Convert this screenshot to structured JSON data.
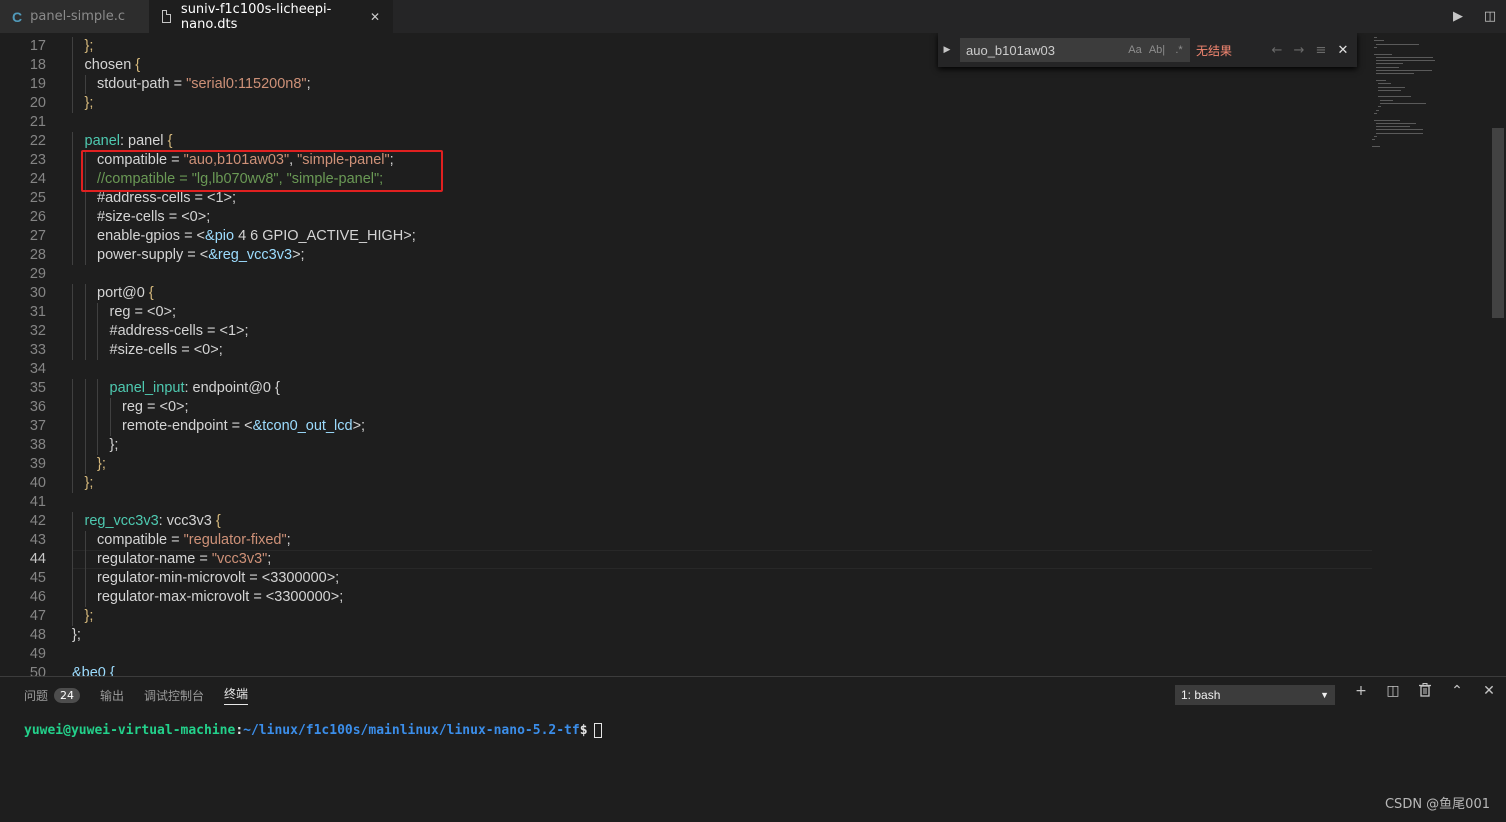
{
  "tabs": [
    {
      "icon": "c-file-icon",
      "label": "panel-simple.c",
      "active": false
    },
    {
      "icon": "file-icon",
      "label": "suniv-f1c100s-licheepi-nano.dts",
      "active": true,
      "close": "✕"
    }
  ],
  "editor_actions": {
    "run": "▶",
    "split": "◫"
  },
  "find": {
    "query": "auo_b101aw03",
    "match_case": "Aa",
    "whole_word": "Ab|",
    "regex": ".*",
    "result": "无结果",
    "prev": "←",
    "next": "→",
    "selection": "≡",
    "close": "✕",
    "toggle": "▶"
  },
  "code_lines": [
    {
      "n": "17",
      "indent": 1,
      "tokens": [
        {
          "t": "};",
          "c": "t-brace"
        }
      ]
    },
    {
      "n": "18",
      "indent": 1,
      "tokens": [
        {
          "t": "chosen ",
          "c": "t-plain"
        },
        {
          "t": "{",
          "c": "t-brace"
        }
      ]
    },
    {
      "n": "19",
      "indent": 2,
      "tokens": [
        {
          "t": "stdout-path = ",
          "c": "t-plain"
        },
        {
          "t": "\"serial0:115200n8\"",
          "c": "t-str"
        },
        {
          "t": ";",
          "c": "t-plain"
        }
      ]
    },
    {
      "n": "20",
      "indent": 1,
      "tokens": [
        {
          "t": "};",
          "c": "t-brace"
        }
      ]
    },
    {
      "n": "21",
      "indent": 0,
      "tokens": []
    },
    {
      "n": "22",
      "indent": 1,
      "tokens": [
        {
          "t": "panel",
          "c": "t-label"
        },
        {
          "t": ": panel ",
          "c": "t-plain"
        },
        {
          "t": "{",
          "c": "t-brace"
        }
      ]
    },
    {
      "n": "23",
      "indent": 2,
      "tokens": [
        {
          "t": "compatible = ",
          "c": "t-plain"
        },
        {
          "t": "\"auo,b101aw03\"",
          "c": "t-str"
        },
        {
          "t": ", ",
          "c": "t-plain"
        },
        {
          "t": "\"simple-panel\"",
          "c": "t-str"
        },
        {
          "t": ";",
          "c": "t-plain"
        }
      ]
    },
    {
      "n": "24",
      "indent": 2,
      "tokens": [
        {
          "t": "//compatible = \"lg,lb070wv8\", \"simple-panel\";",
          "c": "t-comment"
        }
      ]
    },
    {
      "n": "25",
      "indent": 2,
      "tokens": [
        {
          "t": "#address-cells = <1>;",
          "c": "t-plain"
        }
      ]
    },
    {
      "n": "26",
      "indent": 2,
      "tokens": [
        {
          "t": "#size-cells = <0>;",
          "c": "t-plain"
        }
      ]
    },
    {
      "n": "27",
      "indent": 2,
      "tokens": [
        {
          "t": "enable-gpios = <",
          "c": "t-plain"
        },
        {
          "t": "&pio",
          "c": "t-ref"
        },
        {
          "t": " 4 6 GPIO_ACTIVE_HIGH>;",
          "c": "t-plain"
        }
      ]
    },
    {
      "n": "28",
      "indent": 2,
      "tokens": [
        {
          "t": "power-supply = <",
          "c": "t-plain"
        },
        {
          "t": "&reg_vcc3v3",
          "c": "t-ref"
        },
        {
          "t": ">;",
          "c": "t-plain"
        }
      ]
    },
    {
      "n": "29",
      "indent": 0,
      "tokens": []
    },
    {
      "n": "30",
      "indent": 2,
      "tokens": [
        {
          "t": "port@0 ",
          "c": "t-plain"
        },
        {
          "t": "{",
          "c": "t-brace"
        }
      ]
    },
    {
      "n": "31",
      "indent": 3,
      "tokens": [
        {
          "t": "reg = <0>;",
          "c": "t-plain"
        }
      ]
    },
    {
      "n": "32",
      "indent": 3,
      "tokens": [
        {
          "t": "#address-cells = <1>;",
          "c": "t-plain"
        }
      ]
    },
    {
      "n": "33",
      "indent": 3,
      "tokens": [
        {
          "t": "#size-cells = <0>;",
          "c": "t-plain"
        }
      ]
    },
    {
      "n": "34",
      "indent": 0,
      "tokens": []
    },
    {
      "n": "35",
      "indent": 3,
      "tokens": [
        {
          "t": "panel_input",
          "c": "t-label"
        },
        {
          "t": ": endpoint@0 {",
          "c": "t-plain"
        }
      ]
    },
    {
      "n": "36",
      "indent": 4,
      "tokens": [
        {
          "t": "reg = <0>;",
          "c": "t-plain"
        }
      ]
    },
    {
      "n": "37",
      "indent": 4,
      "tokens": [
        {
          "t": "remote-endpoint = <",
          "c": "t-plain"
        },
        {
          "t": "&tcon0_out_lcd",
          "c": "t-ref"
        },
        {
          "t": ">;",
          "c": "t-plain"
        }
      ]
    },
    {
      "n": "38",
      "indent": 3,
      "tokens": [
        {
          "t": "};",
          "c": "t-plain"
        }
      ]
    },
    {
      "n": "39",
      "indent": 2,
      "tokens": [
        {
          "t": "};",
          "c": "t-brace"
        }
      ]
    },
    {
      "n": "40",
      "indent": 1,
      "tokens": [
        {
          "t": "};",
          "c": "t-brace"
        }
      ]
    },
    {
      "n": "41",
      "indent": 0,
      "tokens": []
    },
    {
      "n": "42",
      "indent": 1,
      "tokens": [
        {
          "t": "reg_vcc3v3",
          "c": "t-label"
        },
        {
          "t": ": vcc3v3 ",
          "c": "t-plain"
        },
        {
          "t": "{",
          "c": "t-brace"
        }
      ]
    },
    {
      "n": "43",
      "indent": 2,
      "tokens": [
        {
          "t": "compatible = ",
          "c": "t-plain"
        },
        {
          "t": "\"regulator-fixed\"",
          "c": "t-str"
        },
        {
          "t": ";",
          "c": "t-plain"
        }
      ]
    },
    {
      "n": "44",
      "indent": 2,
      "tokens": [
        {
          "t": "regulator-name = ",
          "c": "t-plain"
        },
        {
          "t": "\"vcc3v3\"",
          "c": "t-str"
        },
        {
          "t": ";",
          "c": "t-plain"
        }
      ]
    },
    {
      "n": "45",
      "indent": 2,
      "tokens": [
        {
          "t": "regulator-min-microvolt = <3300000>;",
          "c": "t-plain"
        }
      ]
    },
    {
      "n": "46",
      "indent": 2,
      "tokens": [
        {
          "t": "regulator-max-microvolt = <3300000>;",
          "c": "t-plain"
        }
      ]
    },
    {
      "n": "47",
      "indent": 1,
      "tokens": [
        {
          "t": "};",
          "c": "t-brace"
        }
      ]
    },
    {
      "n": "48",
      "indent": 0,
      "tokens": [
        {
          "t": "};",
          "c": "t-plain"
        }
      ]
    },
    {
      "n": "49",
      "indent": 0,
      "tokens": []
    },
    {
      "n": "50",
      "indent": 0,
      "tokens": [
        {
          "t": "&be0 {",
          "c": "t-ref"
        }
      ]
    }
  ],
  "current_line": "44",
  "panel": {
    "tabs": [
      {
        "label": "问题",
        "badge": "24",
        "active": false
      },
      {
        "label": "输出",
        "active": false
      },
      {
        "label": "调试控制台",
        "active": false
      },
      {
        "label": "终端",
        "active": true
      }
    ],
    "terminal_select": "1: bash",
    "actions": {
      "new": "+",
      "split": "◫",
      "kill": "🗑",
      "maximize": "⌃",
      "close": "✕"
    }
  },
  "terminal": {
    "user": "yuwei@yuwei-virtual-machine",
    "sep": ":",
    "path": "~/linux/f1c100s/mainlinux/linux-nano-5.2-tf",
    "prompt": "$"
  },
  "watermark": "CSDN @鱼尾001"
}
